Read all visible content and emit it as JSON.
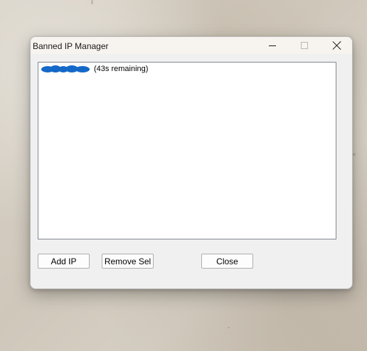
{
  "window": {
    "title": "Banned IP Manager"
  },
  "banned_list": {
    "items": [
      {
        "ip_redacted": true,
        "status": "(43s remaining)"
      }
    ]
  },
  "buttons": {
    "add_label": "Add IP",
    "remove_label": "Remove Sel",
    "close_label": "Close"
  },
  "icons": {
    "minimize": "minimize-icon",
    "maximize": "maximize-icon",
    "close": "close-icon"
  },
  "colors": {
    "redaction": "#1468c8",
    "window_bg": "#f0f0f0",
    "titlebar_bg": "#f7f3ee"
  }
}
